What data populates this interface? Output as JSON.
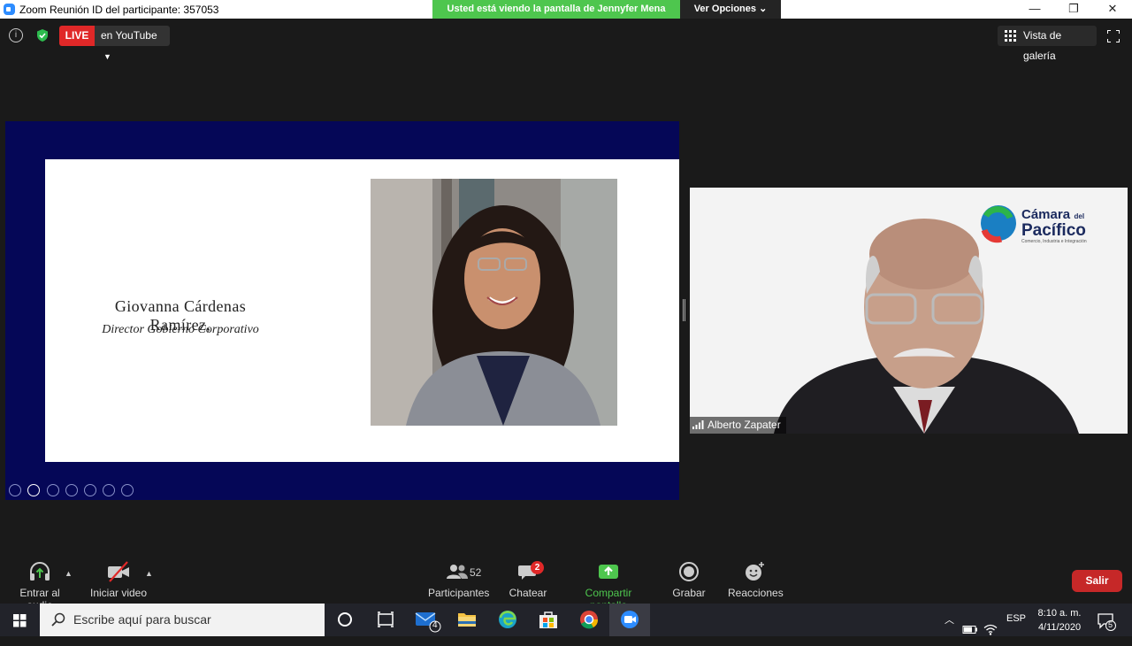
{
  "titlebar": {
    "title": "Zoom Reunión ID del participante: 357053",
    "share_banner": "Usted está viendo la pantalla de Jennyfer Mena",
    "view_options": "Ver Opciones",
    "minimize": "—",
    "restore": "❐",
    "close": "✕"
  },
  "top_controls": {
    "live_label": "LIVE",
    "live_target": "en YouTube",
    "gallery_view": "Vista de galería"
  },
  "slide": {
    "name": "Giovanna Cárdenas Ramírez,",
    "role": "Director Gobierno Corporativo",
    "background_color": "#050757"
  },
  "video": {
    "participant_name": "Alberto Zapater",
    "logo_line1": "Cámara",
    "logo_suffix": "del",
    "logo_line2": "Pacífico",
    "logo_tagline": "Comercio, Industria e Integración"
  },
  "toolbar": {
    "audio_label": "Entrar al audio",
    "video_label": "Iniciar video",
    "participants_label": "Participantes",
    "participants_count": "52",
    "chat_label": "Chatear",
    "chat_badge": "2",
    "share_label": "Compartir pantalla",
    "record_label": "Grabar",
    "reactions_label": "Reacciones",
    "leave_label": "Salir"
  },
  "taskbar": {
    "search_placeholder": "Escribe aquí para buscar",
    "mail_badge": "4",
    "language": "ESP",
    "time": "8:10 a. m.",
    "date": "4/11/2020",
    "notifications_count": "5"
  }
}
